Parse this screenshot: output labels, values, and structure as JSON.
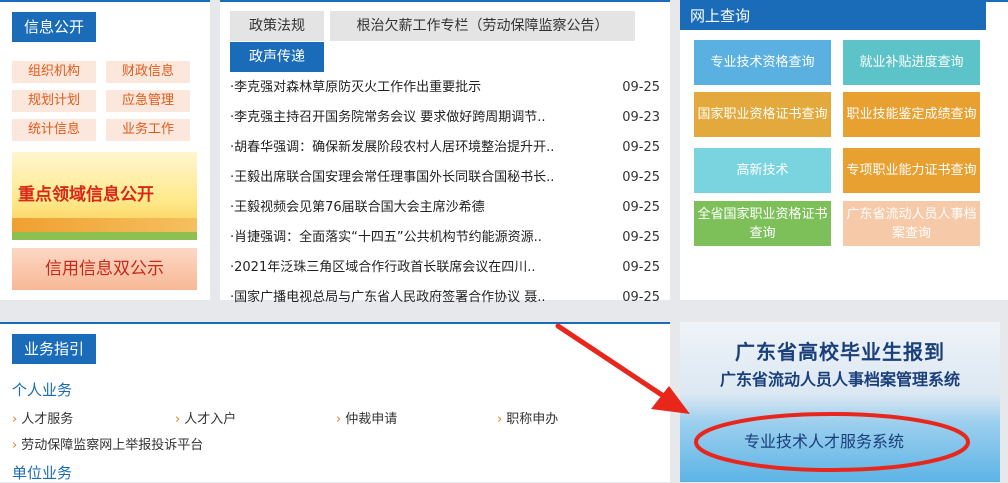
{
  "info": {
    "title": "信息公开",
    "tags": [
      "组织机构",
      "财政信息",
      "规划计划",
      "应急管理",
      "统计信息",
      "业务工作"
    ],
    "banner1": "重点领域信息公开",
    "banner2": "信用信息双公示"
  },
  "news": {
    "tabs": [
      "政策法规",
      "根治欠薪工作专栏（劳动保障监察公告）",
      "政声传递"
    ],
    "items": [
      {
        "title": "·李克强对森林草原防灭火工作作出重要批示",
        "date": "09-25"
      },
      {
        "title": "·李克强主持召开国务院常务会议 要求做好跨周期调节..",
        "date": "09-23"
      },
      {
        "title": "·胡春华强调：确保新发展阶段农村人居环境整治提升开..",
        "date": "09-25"
      },
      {
        "title": "·王毅出席联合国安理会常任理事国外长同联合国秘书长..",
        "date": "09-25"
      },
      {
        "title": "·王毅视频会见第76届联合国大会主席沙希德",
        "date": "09-25"
      },
      {
        "title": "·肖捷强调：全面落实“十四五”公共机构节约能源资源..",
        "date": "09-25"
      },
      {
        "title": "·2021年泛珠三角区域合作行政首长联席会议在四川..",
        "date": "09-25"
      },
      {
        "title": "·国家广播电视总局与广东省人民政府签署合作协议 聂..",
        "date": "09-25"
      }
    ]
  },
  "query": {
    "title": "网上查询",
    "buttons": [
      {
        "label": "专业技术资格查询",
        "color": "#5ab0e0"
      },
      {
        "label": "就业补贴进度查询",
        "color": "#5cc4c8"
      },
      {
        "label": "国家职业资格证书查询",
        "color": "#e3a93c"
      },
      {
        "label": "职业技能鉴定成绩查询",
        "color": "#e8a030"
      },
      {
        "label": "高新技术",
        "color": "#7ad4e0"
      },
      {
        "label": "专项职业能力证书查询",
        "color": "#e8a030"
      },
      {
        "label": "全省国家职业资格证书查询",
        "color": "#7dc05a"
      },
      {
        "label": "广东省流动人员人事档案查询",
        "color": "#f6c9a8"
      }
    ]
  },
  "guide": {
    "title": "业务指引",
    "personal": "个人业务",
    "personal_items": [
      "人才服务",
      "人才入户",
      "仲裁申请",
      "职称申办",
      "劳动保障监察网上举报投诉平台"
    ],
    "unit": "单位业务"
  },
  "promo": {
    "line1": "广东省高校毕业生报到",
    "line2": "广东省流动人员人事档案管理系统",
    "button": "专业技术人才服务系统"
  }
}
